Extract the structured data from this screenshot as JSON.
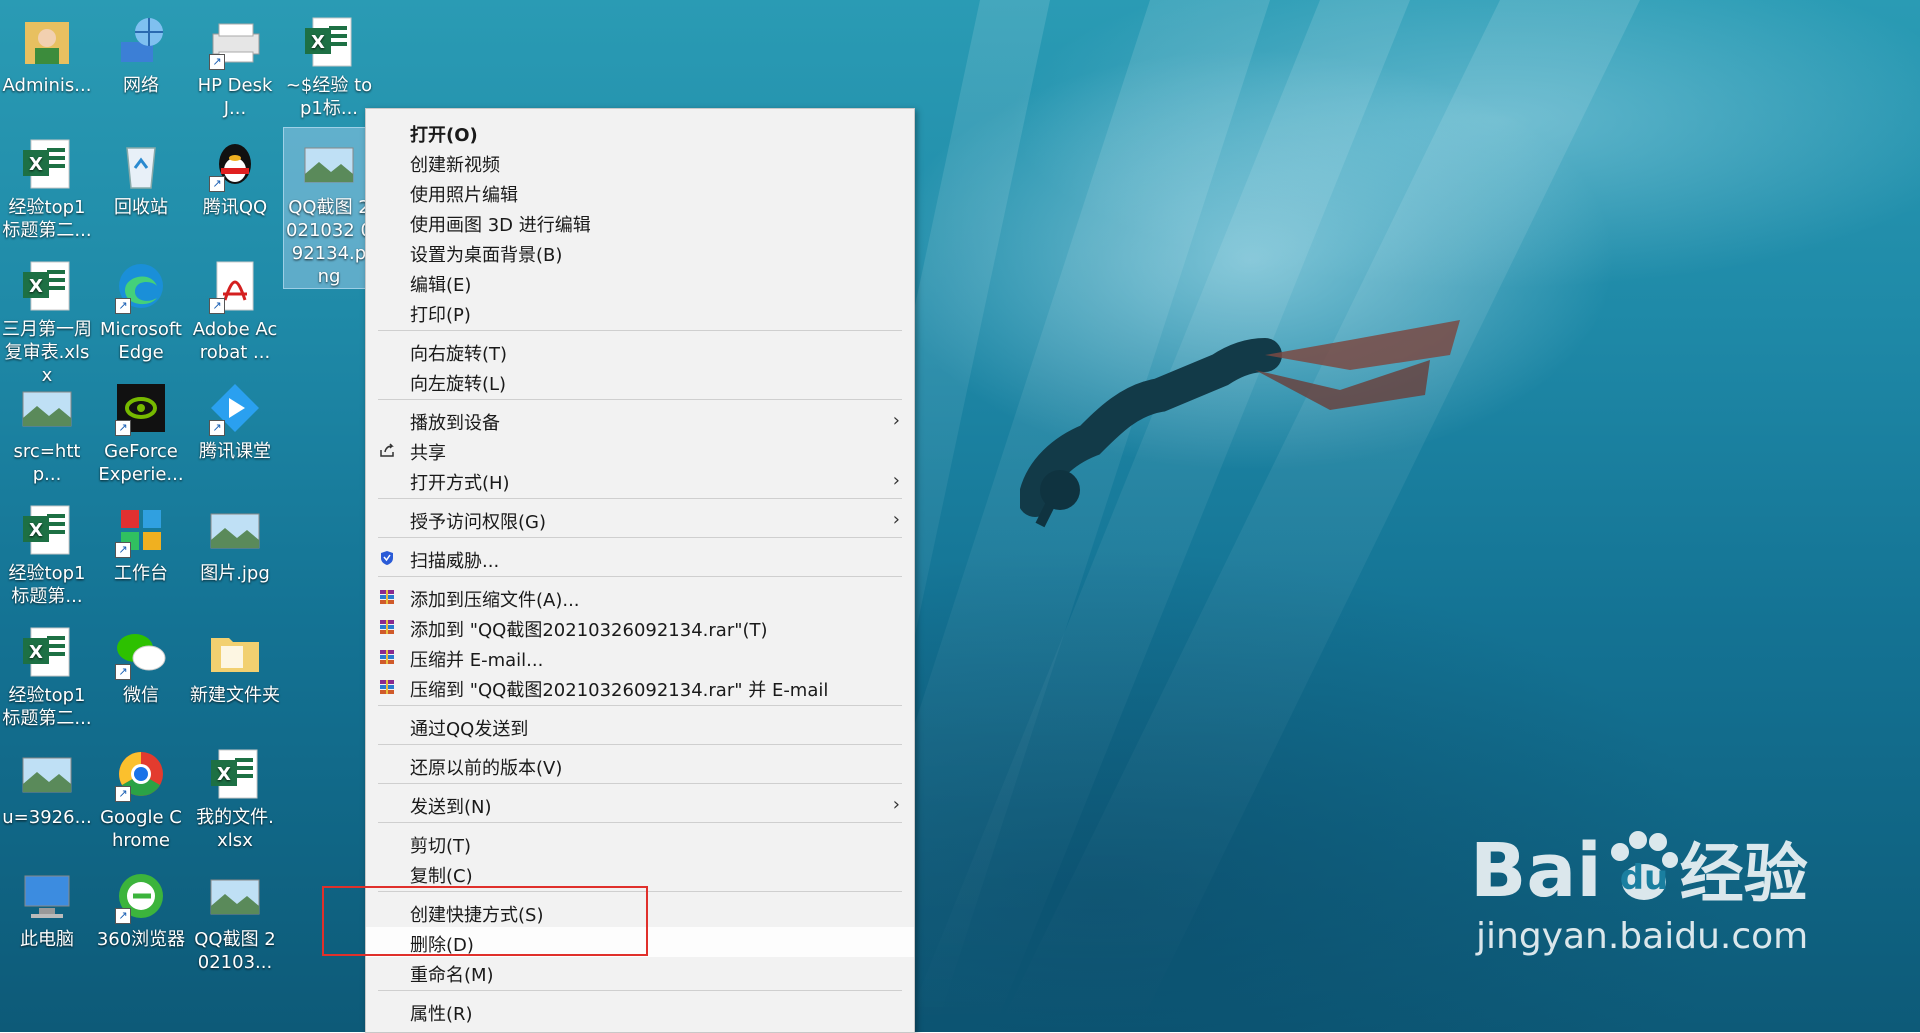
{
  "desktop_icons": [
    {
      "label": "Adminis...",
      "icon": "user-folder-icon"
    },
    {
      "label": "网络",
      "icon": "network-icon"
    },
    {
      "label": "HP DeskJ...",
      "icon": "printer-icon"
    },
    {
      "label": "~$经验 top1标...",
      "icon": "excel-icon"
    },
    {
      "label": "经验top1 标题第二...",
      "icon": "excel-icon"
    },
    {
      "label": "回收站",
      "icon": "recycle-bin-icon"
    },
    {
      "label": "腾讯QQ",
      "icon": "qq-icon"
    },
    {
      "label": "QQ截图 2021032 092134.p ng",
      "icon": "image-icon"
    },
    {
      "label": "三月第一周 复审表.xlsx",
      "icon": "excel-icon"
    },
    {
      "label": "Microsoft Edge",
      "icon": "edge-icon"
    },
    {
      "label": "Adobe Acrobat ...",
      "icon": "acrobat-icon"
    },
    {
      "label": "src=http...",
      "icon": "image-icon"
    },
    {
      "label": "GeForce Experie...",
      "icon": "nvidia-icon"
    },
    {
      "label": "腾讯课堂",
      "icon": "tencent-classroom-icon"
    },
    {
      "label": "经验top1 标题第...",
      "icon": "excel-icon"
    },
    {
      "label": "工作台",
      "icon": "workbench-icon"
    },
    {
      "label": "图片.jpg",
      "icon": "image-icon"
    },
    {
      "label": "经验top1 标题第二...",
      "icon": "excel-icon"
    },
    {
      "label": "微信",
      "icon": "wechat-icon"
    },
    {
      "label": "新建文件夹",
      "icon": "folder-icon"
    },
    {
      "label": "u=3926...",
      "icon": "image-icon"
    },
    {
      "label": "Google Chrome",
      "icon": "chrome-icon"
    },
    {
      "label": "我的文件. xlsx",
      "icon": "excel-icon"
    },
    {
      "label": "此电脑",
      "icon": "computer-icon"
    },
    {
      "label": "360浏览器",
      "icon": "360-browser-icon"
    },
    {
      "label": "QQ截图 202103...",
      "icon": "image-icon"
    }
  ],
  "context_menu": {
    "items": [
      {
        "label": "打开(O)"
      },
      {
        "label": "创建新视频"
      },
      {
        "label": "使用照片编辑"
      },
      {
        "label": "使用画图 3D 进行编辑"
      },
      {
        "label": "设置为桌面背景(B)"
      },
      {
        "label": "编辑(E)"
      },
      {
        "label": "打印(P)"
      },
      {
        "label": "向右旋转(T)"
      },
      {
        "label": "向左旋转(L)"
      },
      {
        "label": "播放到设备"
      },
      {
        "label": "共享"
      },
      {
        "label": "打开方式(H)"
      },
      {
        "label": "授予访问权限(G)"
      },
      {
        "label": "扫描威胁..."
      },
      {
        "label": "添加到压缩文件(A)..."
      },
      {
        "label": "添加到 \"QQ截图20210326092134.rar\"(T)"
      },
      {
        "label": "压缩并 E-mail..."
      },
      {
        "label": "压缩到 \"QQ截图20210326092134.rar\" 并 E-mail"
      },
      {
        "label": "通过QQ发送到"
      },
      {
        "label": "还原以前的版本(V)"
      },
      {
        "label": "发送到(N)"
      },
      {
        "label": "剪切(T)"
      },
      {
        "label": "复制(C)"
      },
      {
        "label": "创建快捷方式(S)"
      },
      {
        "label": "删除(D)"
      },
      {
        "label": "重命名(M)"
      },
      {
        "label": "属性(R)"
      }
    ]
  },
  "watermark": {
    "brand": "Bai",
    "brand2": "du",
    "brand3": "经验",
    "url": "jingyan.baidu.com"
  },
  "colors": {
    "highlight_box": "#e0302b",
    "menu_bg": "#f2f2f2",
    "excel_green": "#1d7044"
  }
}
